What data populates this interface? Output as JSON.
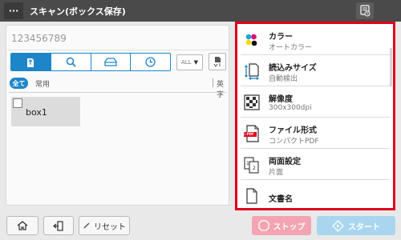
{
  "header": {
    "menu_label": "···",
    "title": "スキャン(ボックス保存)"
  },
  "destination": {
    "value": "123456789"
  },
  "box_view": {
    "tabs": [
      {
        "icon": "box-icon",
        "active": true
      },
      {
        "icon": "search-icon",
        "active": false
      },
      {
        "icon": "tray-icon",
        "active": false
      },
      {
        "icon": "clock-icon",
        "active": false
      }
    ],
    "all_dropdown_label": "ALL",
    "filters": {
      "all": "全て",
      "common": "常用",
      "alpha": "英字"
    },
    "boxes": [
      {
        "name": "box1"
      }
    ]
  },
  "settings": [
    {
      "icon": "color-icon",
      "label": "カラー",
      "value": "オートカラー"
    },
    {
      "icon": "scan-size-icon",
      "label": "読込みサイズ",
      "value": "自動検出"
    },
    {
      "icon": "resolution-icon",
      "label": "解像度",
      "value": "300x300dpi"
    },
    {
      "icon": "file-format-icon",
      "label": "ファイル形式",
      "value": "コンパクトPDF",
      "badge": "C-PDF"
    },
    {
      "icon": "duplex-icon",
      "label": "両面設定",
      "value": "片面"
    },
    {
      "icon": "document-name-icon",
      "label": "文書名",
      "value": ""
    }
  ],
  "bottom": {
    "reset_label": "リセット",
    "stop_label": "ストップ",
    "start_label": "スタート"
  },
  "colors": {
    "highlight": "#e0001b",
    "accent": "#1e86c8",
    "stop": "#f3a4b2",
    "start": "#a9d6ee",
    "header": "#4a4a4a"
  }
}
